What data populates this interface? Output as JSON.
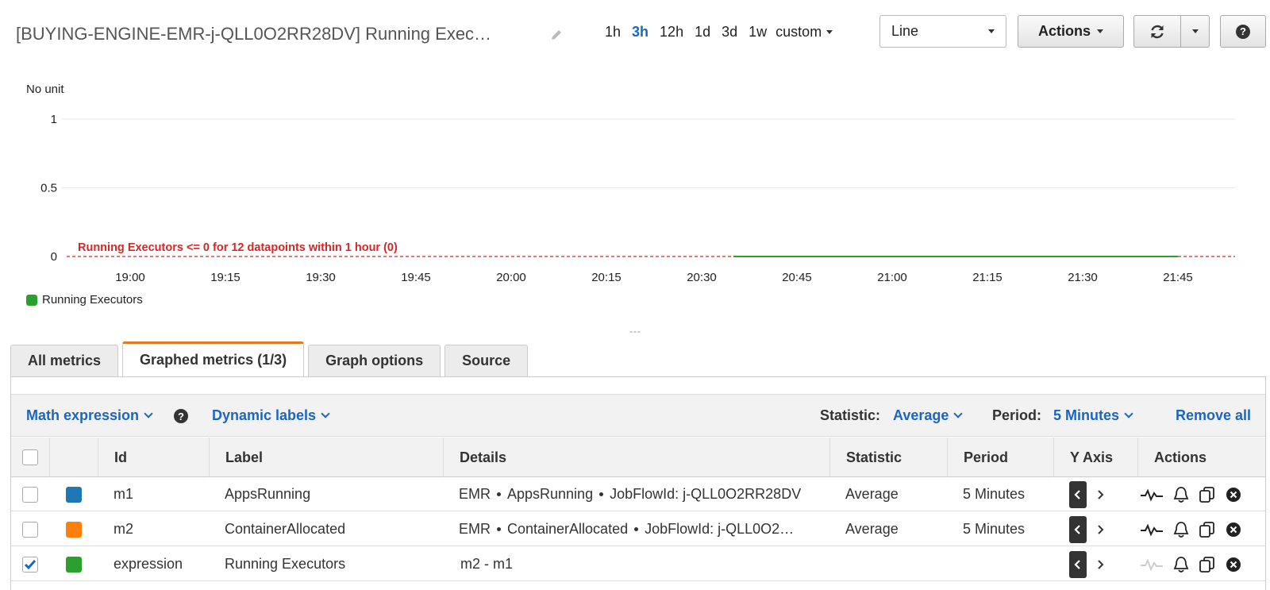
{
  "header": {
    "title": "[BUYING-ENGINE-EMR-j-QLL0O2RR28DV] Running Exec…",
    "ranges": [
      "1h",
      "3h",
      "12h",
      "1d",
      "3d",
      "1w"
    ],
    "active_range": "3h",
    "custom_label": "custom",
    "graph_type": "Line",
    "actions_label": "Actions"
  },
  "chart_data": {
    "type": "line",
    "ylabel": "No unit",
    "ylim": [
      0,
      1
    ],
    "yticks": [
      "1",
      "0.5",
      "0"
    ],
    "x_ticks": [
      "19:00",
      "19:15",
      "19:30",
      "19:45",
      "20:00",
      "20:15",
      "20:30",
      "20:45",
      "21:00",
      "21:15",
      "21:30",
      "21:45"
    ],
    "series": [
      {
        "name": "Running Executors",
        "color": "#2ca02c",
        "x": [
          "20:35",
          "21:45"
        ],
        "values": [
          0,
          0
        ]
      }
    ],
    "threshold": {
      "label": "Running Executors <= 0 for 12 datapoints within 1 hour (0)",
      "value": 0,
      "color": "#d62728"
    },
    "legend": "bottom-left",
    "grid": true
  },
  "chart": {
    "unit_label": "No unit",
    "legend_label": "Running Executors"
  },
  "tabs": [
    {
      "label": "All metrics",
      "active": false
    },
    {
      "label": "Graphed metrics (1/3)",
      "active": true
    },
    {
      "label": "Graph options",
      "active": false
    },
    {
      "label": "Source",
      "active": false
    }
  ],
  "toolbar": {
    "math_expression": "Math expression",
    "dynamic_labels": "Dynamic labels",
    "statistic_label": "Statistic:",
    "statistic_value": "Average",
    "period_label": "Period:",
    "period_value": "5 Minutes",
    "remove_all": "Remove all"
  },
  "table": {
    "headers": [
      "Id",
      "Label",
      "Details",
      "Statistic",
      "Period",
      "Y Axis",
      "Actions"
    ],
    "rows": [
      {
        "checked": false,
        "color": "#1f77b4",
        "id": "m1",
        "label": "AppsRunning",
        "details": [
          "EMR",
          "AppsRunning",
          "JobFlowId: j-QLL0O2RR28DV"
        ],
        "statistic": "Average",
        "period": "5 Minutes"
      },
      {
        "checked": false,
        "color": "#ff7f0e",
        "id": "m2",
        "label": "ContainerAllocated",
        "details": [
          "EMR",
          "ContainerAllocated",
          "JobFlowId: j-QLL0O2…"
        ],
        "statistic": "Average",
        "period": "5 Minutes"
      },
      {
        "checked": true,
        "color": "#2ca02c",
        "id": "expression",
        "label": "Running Executors",
        "details": [
          "m2 - m1"
        ],
        "statistic": "",
        "period": ""
      }
    ]
  }
}
